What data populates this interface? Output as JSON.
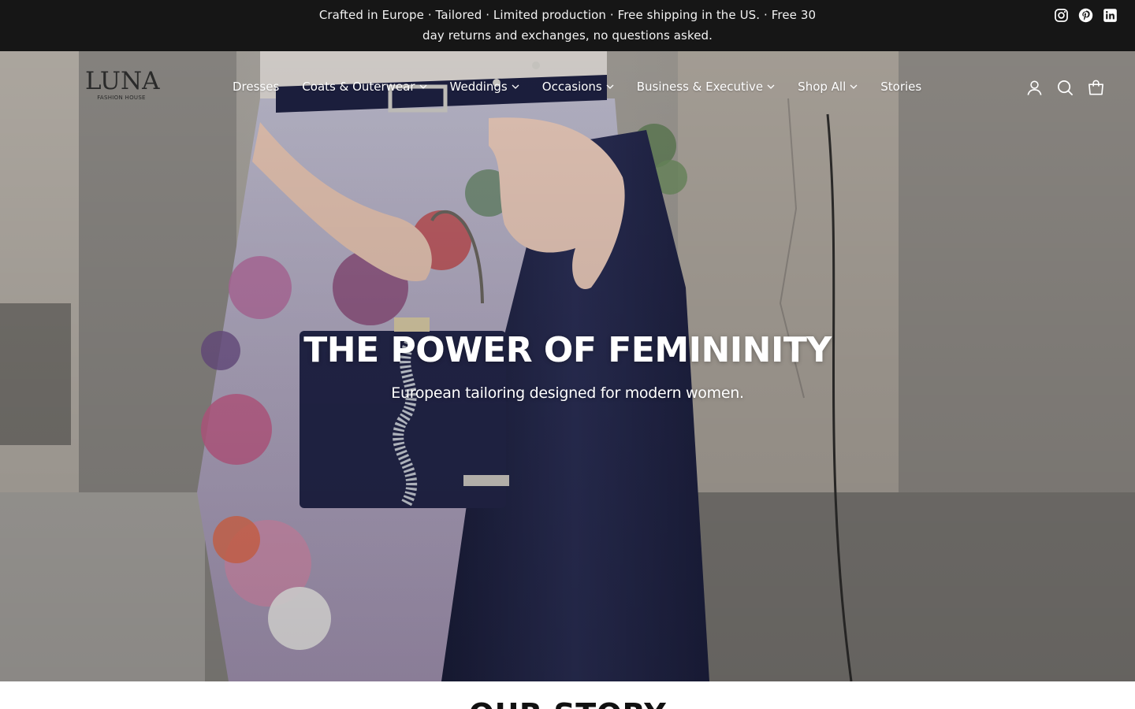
{
  "announcement": {
    "text": "Crafted in Europe · Tailored · Limited production · Free shipping in the US. · Free 30 day returns and exchanges, no questions asked.",
    "social_icons": [
      "instagram-icon",
      "pinterest-icon",
      "linkedin-icon"
    ]
  },
  "header": {
    "logo": {
      "main": "LUNA",
      "sub": "FASHION HOUSE"
    },
    "nav": [
      {
        "label": "Dresses",
        "dropdown": false
      },
      {
        "label": "Coats & Outerwear",
        "dropdown": true
      },
      {
        "label": "Weddings",
        "dropdown": true
      },
      {
        "label": "Occasions",
        "dropdown": true
      },
      {
        "label": "Business & Executive",
        "dropdown": true
      },
      {
        "label": "Shop All",
        "dropdown": true
      },
      {
        "label": "Stories",
        "dropdown": false
      }
    ],
    "icons": [
      "account-icon",
      "search-icon",
      "cart-icon"
    ]
  },
  "hero": {
    "title": "THE POWER OF FEMININITY",
    "subtitle": "European tailoring designed for modern women."
  },
  "next_section": {
    "title": "OUR STORY"
  },
  "colors": {
    "announcement_bg": "#161616",
    "text_light": "#ffffff"
  }
}
